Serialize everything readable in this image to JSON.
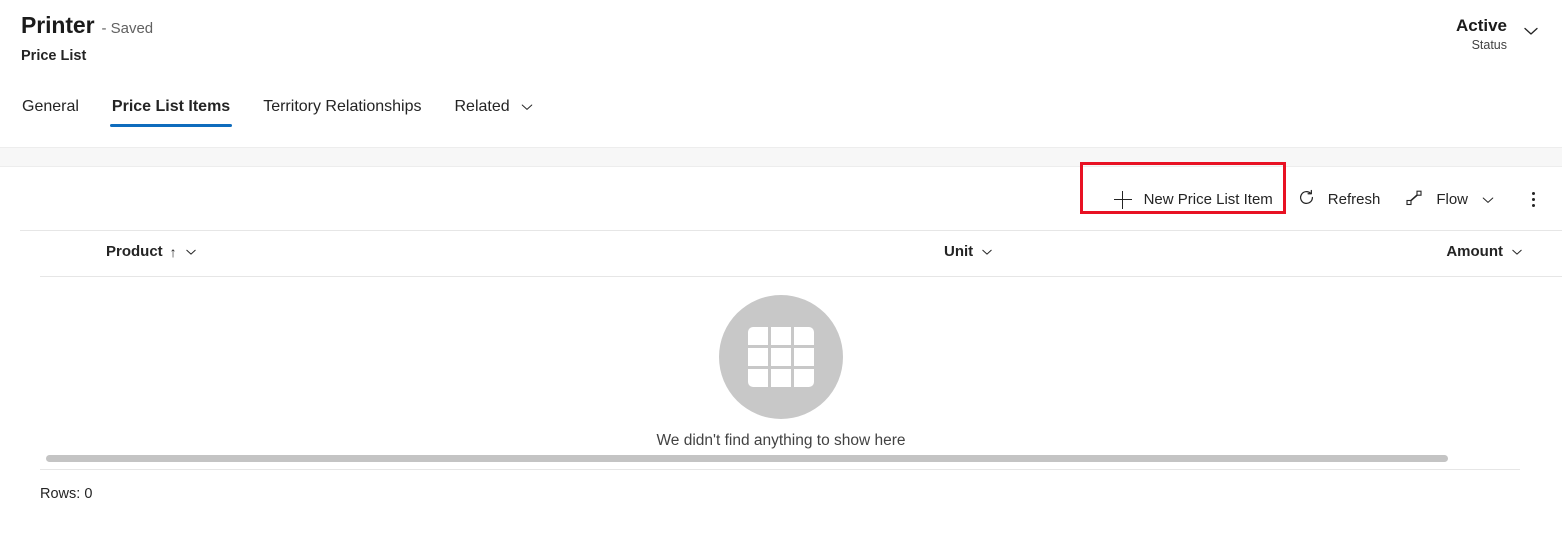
{
  "record": {
    "title": "Printer",
    "saved_label": "- Saved",
    "subtitle": "Price List",
    "status_value": "Active",
    "status_label": "Status",
    "status_chevron_icon": "chevron-down-icon"
  },
  "tabs": [
    {
      "label": "General",
      "active": false
    },
    {
      "label": "Price List Items",
      "active": true
    },
    {
      "label": "Territory Relationships",
      "active": false
    },
    {
      "label": "Related",
      "active": false,
      "chevron_icon": "chevron-down-icon"
    }
  ],
  "commandbar": {
    "new_item_label": "New Price List Item",
    "new_item_icon": "plus-icon",
    "refresh_label": "Refresh",
    "refresh_icon": "refresh-icon",
    "flow_label": "Flow",
    "flow_icon": "flow-icon",
    "flow_chevron_icon": "chevron-down-icon",
    "overflow_icon": "more-vertical-icon"
  },
  "grid": {
    "columns": [
      {
        "label": "Product",
        "sort_icon": "sort-ascending-icon",
        "chevron_icon": "chevron-down-icon"
      },
      {
        "label": "Unit",
        "chevron_icon": "chevron-down-icon"
      },
      {
        "label": "Amount",
        "chevron_icon": "chevron-down-icon"
      }
    ],
    "empty_message": "We didn't find anything to show here",
    "empty_icon": "table-grid-icon",
    "rows_label": "Rows: 0"
  },
  "colors": {
    "accent": "#0f6cbd",
    "highlight": "#e81123",
    "empty_circle": "#c8c8c8",
    "text": "#242424"
  }
}
